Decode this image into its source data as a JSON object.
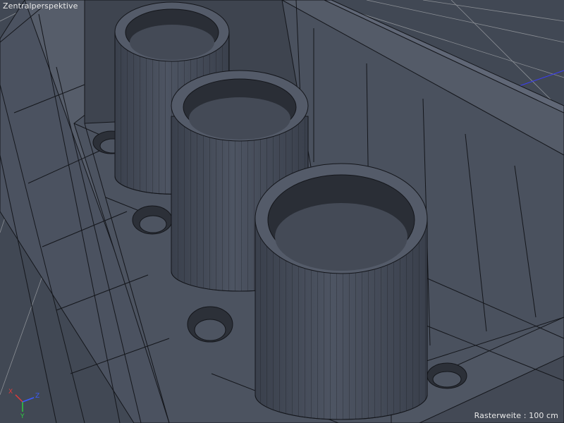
{
  "viewport": {
    "title": "Zentralperspektive",
    "grid_label": "Rasterweite : 100 cm",
    "axis_labels": {
      "x": "X",
      "y": "Y",
      "z": "Z"
    },
    "axis_colors": {
      "x": "#e03a3a",
      "y": "#2ecc40",
      "z": "#3a5bff"
    },
    "colors": {
      "background": "#414854",
      "grid": "#8b8f95",
      "model_face": "#4b5260",
      "model_face_dark": "#353b46",
      "wireframe": "#14161b",
      "label_text": "#e8e8e8"
    }
  },
  "scene": {
    "objects": [
      "tray",
      "cylinder",
      "cylinder",
      "cylinder",
      "hole",
      "hole",
      "hole",
      "hole",
      "hole"
    ]
  }
}
